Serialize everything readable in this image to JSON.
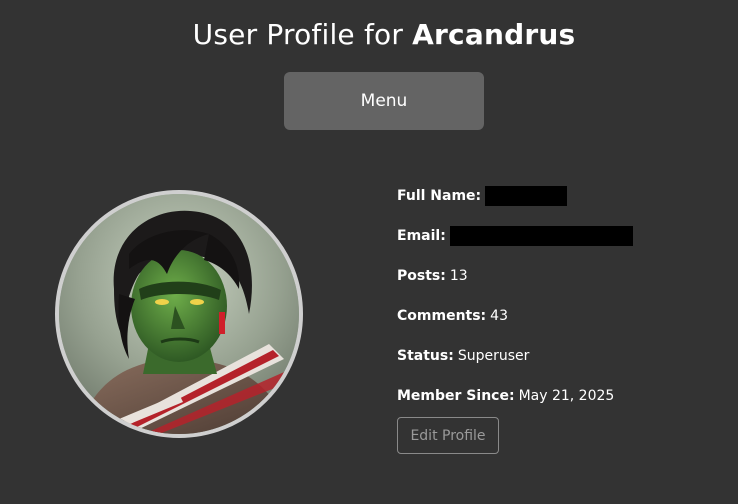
{
  "header": {
    "title_prefix": "User Profile for",
    "username": "Arcandrus"
  },
  "menu_label": "Menu",
  "avatar": {
    "icon": "orc-warrior-portrait"
  },
  "profile": {
    "full_name_label": "Full Name:",
    "email_label": "Email:",
    "posts_label": "Posts:",
    "posts_value": "13",
    "comments_label": "Comments:",
    "comments_value": "43",
    "status_label": "Status:",
    "status_value": "Superuser",
    "member_since_label": "Member Since:",
    "member_since_value": "May 21, 2025"
  },
  "edit_profile_label": "Edit Profile",
  "colors": {
    "background": "#333333",
    "menu_button": "#646464",
    "redaction": "#000000",
    "avatar_border": "#cfcfcf"
  }
}
